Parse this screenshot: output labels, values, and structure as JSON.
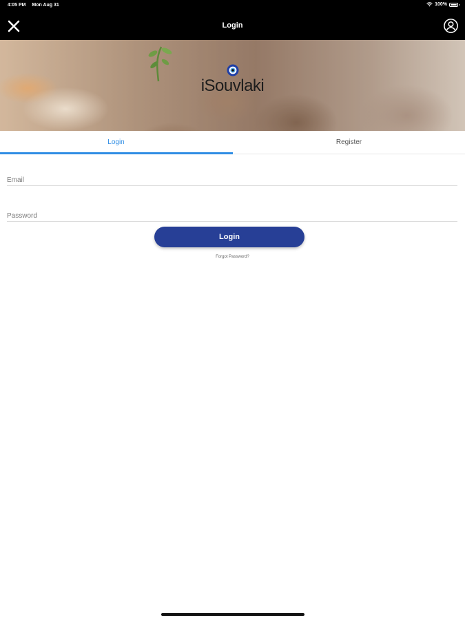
{
  "status_bar": {
    "time": "4:05 PM",
    "date": "Mon Aug 31",
    "battery": "100%",
    "battery_level": 1.0
  },
  "nav": {
    "title": "Login",
    "close_icon": "close-icon",
    "profile_icon": "user-circle-icon"
  },
  "brand": {
    "name": "iSouvlaki",
    "icon": "evil-eye-icon"
  },
  "tabs": [
    {
      "label": "Login",
      "active": true
    },
    {
      "label": "Register",
      "active": false
    }
  ],
  "form": {
    "email_placeholder": "Email",
    "email_value": "",
    "password_placeholder": "Password",
    "password_value": "",
    "login_button": "Login",
    "forgot_link": "Forgot Password?"
  },
  "colors": {
    "accent_blue": "#2f8de4",
    "button_blue": "#273f96",
    "bar_black": "#000000"
  }
}
